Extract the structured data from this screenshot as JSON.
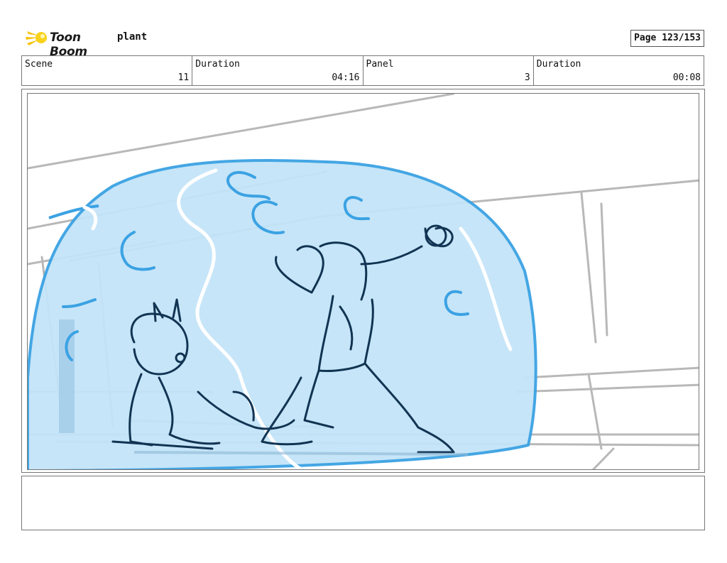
{
  "header": {
    "logo_text": "Toon Boom",
    "project_title": "plant",
    "page_label": "Page 123/153"
  },
  "info": {
    "scene_label": "Scene",
    "scene_value": "11",
    "duration_label": "Duration",
    "duration_value": "04:16",
    "panel_label": "Panel",
    "panel_value": "3",
    "panel_duration_label": "Duration",
    "panel_duration_value": "00:08"
  },
  "notes": {
    "text": ""
  },
  "colors": {
    "bubble_fill": "#c3e4f8",
    "bubble_stroke": "#3ba2e3",
    "ink": "#123453",
    "background_lines": "#b8b8b8"
  }
}
